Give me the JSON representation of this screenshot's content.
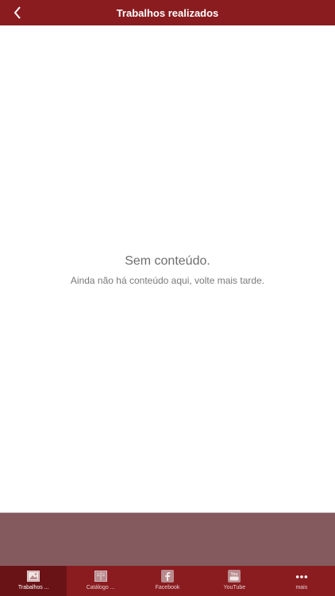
{
  "header": {
    "title": "Trabalhos realizados",
    "back_icon": "chevron-left-icon"
  },
  "empty_state": {
    "title": "Sem conteúdo.",
    "message": "Ainda não há conteúdo aqui, volte mais tarde."
  },
  "tabbar": {
    "tabs": [
      {
        "label": "Trabalhos ...",
        "icon": "image-icon",
        "active": true
      },
      {
        "label": "Catálogo ...",
        "icon": "catalog-icon",
        "active": false
      },
      {
        "label": "Facebook",
        "icon": "facebook-icon",
        "active": false
      },
      {
        "label": "YouTube",
        "icon": "youtube-icon",
        "active": false
      },
      {
        "label": "mais",
        "icon": "more-icon",
        "active": false
      }
    ]
  },
  "colors": {
    "brand": "#8a1c20",
    "tab_active": "#6a1316",
    "banner": "#855a5f"
  }
}
